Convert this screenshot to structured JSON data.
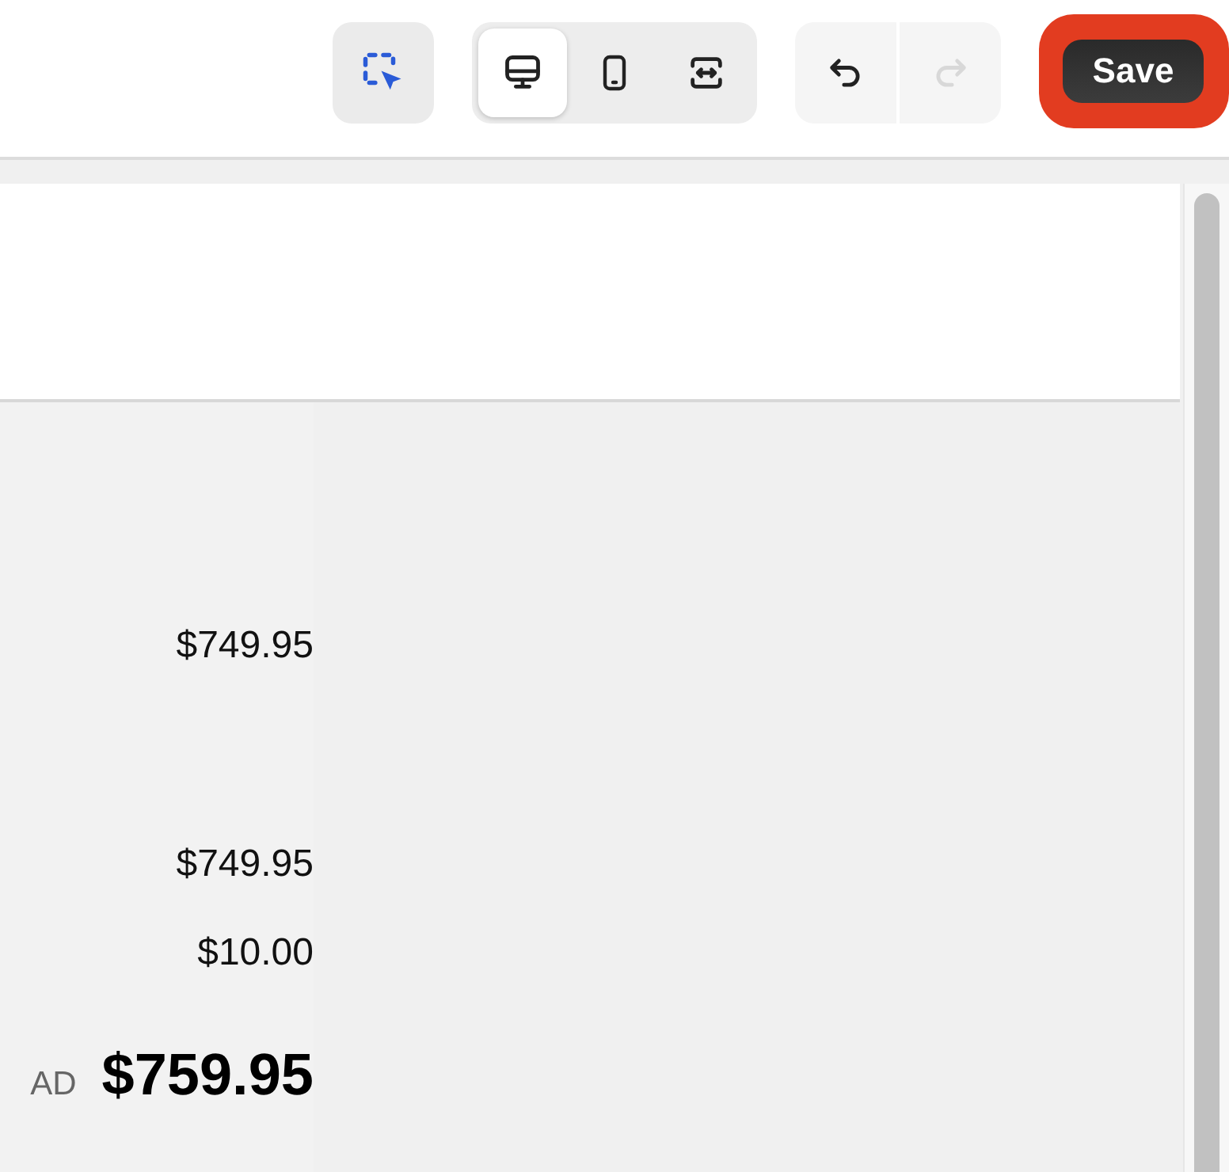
{
  "toolbar": {
    "select_tool": {
      "selected": false
    },
    "devices": [
      {
        "kind": "desktop",
        "selected": true
      },
      {
        "kind": "mobile",
        "selected": false
      },
      {
        "kind": "fit",
        "selected": false
      }
    ],
    "history": [
      {
        "kind": "undo",
        "disabled": false
      },
      {
        "kind": "redo",
        "disabled": true
      }
    ],
    "save": {
      "label": "Save"
    }
  },
  "summary": {
    "lines": [
      {
        "amount": "$749.95"
      },
      {
        "amount": "$749.95"
      },
      {
        "amount": "$10.00"
      }
    ],
    "total": {
      "currency": "AD",
      "amount": "$759.95"
    }
  }
}
